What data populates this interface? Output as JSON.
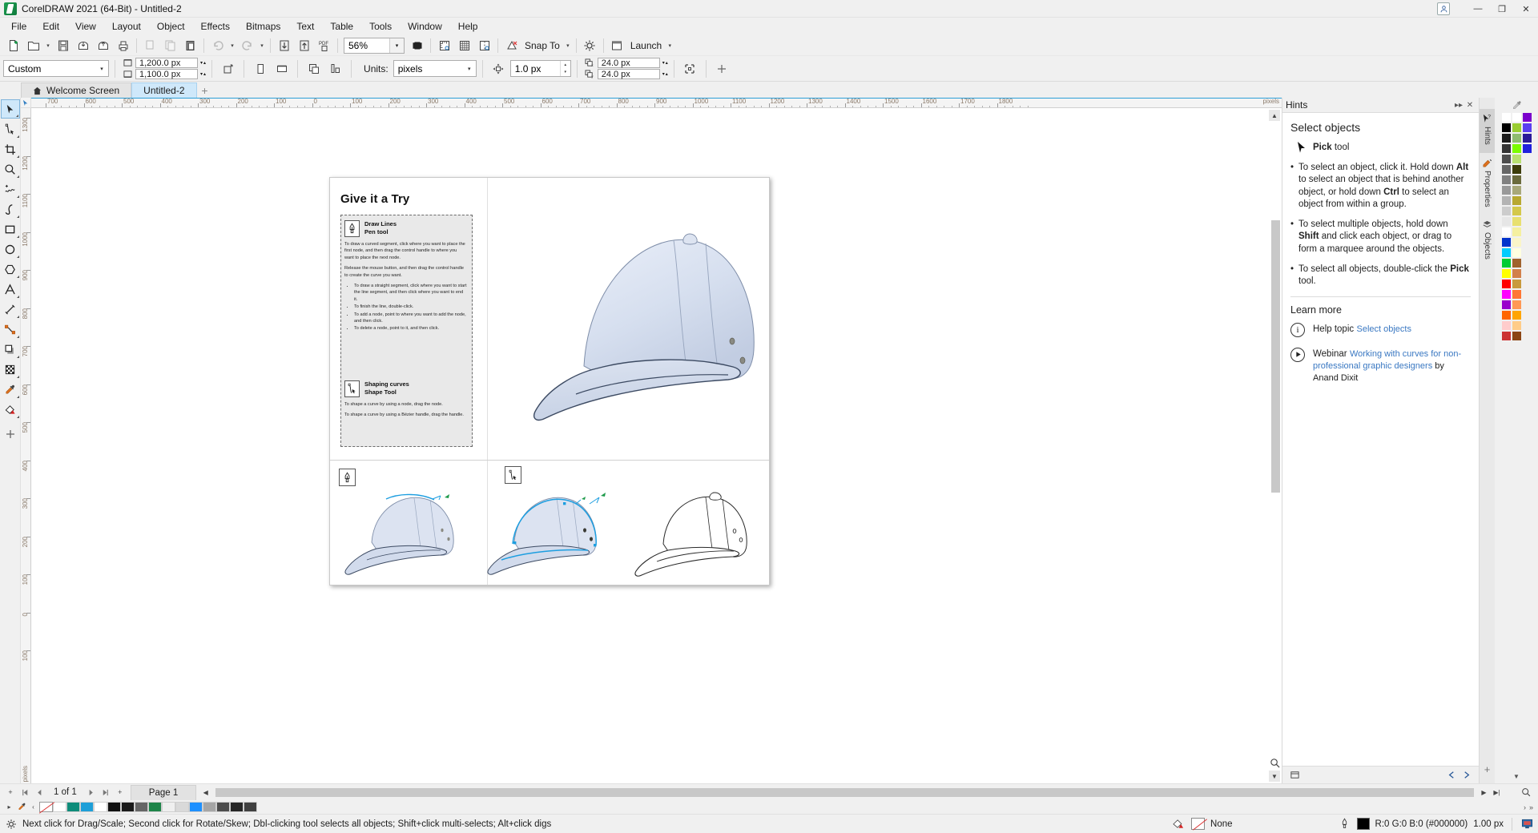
{
  "window": {
    "title": "CorelDRAW 2021 (64-Bit) - Untitled-2",
    "minimize": "—",
    "maximize": "❐",
    "close": "✕"
  },
  "menu": {
    "items": [
      "File",
      "Edit",
      "View",
      "Layout",
      "Object",
      "Effects",
      "Bitmaps",
      "Text",
      "Table",
      "Tools",
      "Window",
      "Help"
    ]
  },
  "toolbar": {
    "buttons": [
      {
        "name": "new-document",
        "tip": "New"
      },
      {
        "name": "open-document",
        "tip": "Open"
      },
      {
        "name": "save-document",
        "tip": "Save"
      },
      {
        "name": "import",
        "tip": "Import"
      },
      {
        "name": "export",
        "tip": "Export"
      },
      {
        "name": "print",
        "tip": "Print"
      },
      {
        "name": "cut",
        "tip": "Cut"
      },
      {
        "name": "copy",
        "tip": "Copy"
      },
      {
        "name": "paste",
        "tip": "Paste"
      },
      {
        "name": "undo",
        "tip": "Undo"
      },
      {
        "name": "redo",
        "tip": "Redo"
      },
      {
        "name": "import-arrow",
        "tip": "Import"
      },
      {
        "name": "export-arrow",
        "tip": "Export"
      },
      {
        "name": "publish-pdf",
        "tip": "Publish to PDF"
      }
    ],
    "zoom_level": "56%",
    "full_screen_tip": "Full-Screen Preview",
    "show_rulers_tip": "Show Rulers",
    "show_grid_tip": "Show Grid",
    "show_guides_tip": "Show Guides",
    "snap_label": "Snap To",
    "options_tip": "Options",
    "launch_label": "Launch"
  },
  "propbar": {
    "page_preset": "Custom",
    "page_width": "1,200.0 px",
    "page_height": "1,100.0 px",
    "units_label": "Units:",
    "units_value": "pixels",
    "nudge_value": "1.0 px",
    "duplicate_x": "24.0 px",
    "duplicate_y": "24.0 px",
    "portrait_tip": "Portrait",
    "landscape_tip": "Landscape",
    "add_tip": "Add"
  },
  "tabs": {
    "home_tip": "Home",
    "items": [
      {
        "label": "Welcome Screen",
        "active": false
      },
      {
        "label": "Untitled-2",
        "active": true
      }
    ],
    "add_label": "+"
  },
  "toolbox": {
    "tools": [
      {
        "name": "pick-tool",
        "active": true
      },
      {
        "name": "shape-tool",
        "active": false
      },
      {
        "name": "crop-tool",
        "active": false
      },
      {
        "name": "zoom-tool",
        "active": false
      },
      {
        "name": "freehand-tool",
        "active": false
      },
      {
        "name": "artistic-media-tool",
        "active": false
      },
      {
        "name": "rectangle-tool",
        "active": false
      },
      {
        "name": "ellipse-tool",
        "active": false
      },
      {
        "name": "polygon-tool",
        "active": false
      },
      {
        "name": "text-tool",
        "active": false
      },
      {
        "name": "parallel-dimension-tool",
        "active": false
      },
      {
        "name": "connector-tool",
        "active": false
      },
      {
        "name": "drop-shadow-tool",
        "active": false
      },
      {
        "name": "transparency-tool",
        "active": false
      },
      {
        "name": "color-eyedropper-tool",
        "active": false
      },
      {
        "name": "interactive-fill-tool",
        "active": false
      },
      {
        "name": "add-tool",
        "active": false
      }
    ]
  },
  "rulers": {
    "unit_label": "pixels",
    "h_labels": [
      "700",
      "600",
      "500",
      "400",
      "300",
      "200",
      "100",
      "0",
      "100",
      "200",
      "300",
      "400",
      "500",
      "600",
      "700",
      "800",
      "900",
      "1000",
      "1100",
      "1200",
      "1300",
      "1400",
      "1500",
      "1600",
      "1700",
      "1800"
    ],
    "v_labels": [
      "1300",
      "1200",
      "1100",
      "1000",
      "900",
      "800",
      "700",
      "600",
      "500",
      "400",
      "300",
      "200",
      "100",
      "0",
      "100"
    ]
  },
  "document": {
    "heading": "Give it a Try",
    "sections": [
      {
        "icon": "pen-tool-icon",
        "title": "Draw Lines",
        "subtitle": "Pen tool",
        "paragraphs": [
          "To draw a curved segment, click where you want to place the first node, and then drag the control handle to where you want to place the next node.",
          "Release the mouse button, and then drag the control handle to create the curve you want."
        ],
        "bullets": [
          "To draw a straight segment, click where you want to start the line segment, and then click where you want to end it.",
          "To finish the line, double-click.",
          "To add a node, point to where you want to add the node, and then click.",
          "To delete a node, point to it, and then click."
        ]
      },
      {
        "icon": "shape-tool-icon",
        "title": "Shaping curves",
        "subtitle": "Shape Tool",
        "paragraphs": [
          "To shape a curve by using a node, drag the node.",
          "To shape a curve by using a Bézier handle, drag the handle."
        ],
        "bullets": []
      }
    ],
    "strip_badges": [
      "pen-tool-icon",
      "shape-tool-icon"
    ]
  },
  "docker": {
    "title": "Hints",
    "collapse_icon": "▸▸",
    "close_icon": "✕",
    "heading": "Select objects",
    "tool_name_bold": "Pick",
    "tool_name_rest": " tool",
    "hints": [
      {
        "parts": [
          {
            "t": "To select an object, click it. Hold down ",
            "b": false
          },
          {
            "t": "Alt",
            "b": true
          },
          {
            "t": " to select an object that is behind another object, or hold down ",
            "b": false
          },
          {
            "t": "Ctrl",
            "b": true
          },
          {
            "t": " to select an object from within a group.",
            "b": false
          }
        ]
      },
      {
        "parts": [
          {
            "t": "To select multiple objects, hold down ",
            "b": false
          },
          {
            "t": "Shift",
            "b": true
          },
          {
            "t": " and click each object, or drag to form a marquee around the objects.",
            "b": false
          }
        ]
      },
      {
        "parts": [
          {
            "t": "To select all objects, double-click the ",
            "b": false
          },
          {
            "t": "Pick",
            "b": true
          },
          {
            "t": " tool.",
            "b": false
          }
        ]
      }
    ],
    "learn_more_heading": "Learn more",
    "learn_items": [
      {
        "icon": "info-icon",
        "title": "Help topic",
        "link": "Select objects",
        "link_suffix": ""
      },
      {
        "icon": "play-icon",
        "title": "Webinar",
        "link": "Working with curves for non-professional graphic designers",
        "link_suffix": " by Anand Dixit"
      }
    ],
    "rail_tabs": [
      {
        "label": "Hints",
        "icon": "pointer-question-icon",
        "active": true
      },
      {
        "label": "Properties",
        "icon": "properties-icon",
        "active": false
      },
      {
        "label": "Objects",
        "icon": "objects-icon",
        "active": false
      }
    ],
    "rail_add": "+"
  },
  "pagenav": {
    "add_page_left": "+",
    "first": "⏮",
    "prev": "◀",
    "counter": "1 of 1",
    "next": "▶",
    "last": "⏭",
    "add_page_right": "+",
    "page_tab": "Page 1"
  },
  "statusbar": {
    "message": "Next click for Drag/Scale; Second click for Rotate/Skew; Dbl-clicking tool selects all objects; Shift+click multi-selects; Alt+click digs",
    "outline_label": "None",
    "fill_color_text": "R:0 G:0 B:0 (#000000)",
    "outline_width": "1.00 px"
  },
  "palette": {
    "eyedropper_icon": "eyedropper-icon",
    "colors": [
      [
        "#ffffff",
        "#000000",
        "#1a1a1a",
        "#333333",
        "#4d4d4d",
        "#666666",
        "#808080",
        "#999999",
        "#b3b3b3",
        "#cccccc",
        "#e6e6e6",
        "#ffffff",
        "#0033cc",
        "#00ccff",
        "#00cc33",
        "#ffff00",
        "#ff0000",
        "#ff00ff",
        "#9900cc",
        "#ff6600",
        "#ffcccc",
        "#cc3333"
      ],
      [
        "#ffffff",
        "#9acd32",
        "#8fbc6f",
        "#7cfc00",
        "#b8e070",
        "#3d3d0a",
        "#6b6b3d",
        "#a8a87a",
        "#b8a830",
        "#d4c84a",
        "#e8e070",
        "#f5f0a0",
        "#faf5c8",
        "#ffffe0",
        "#a0622d",
        "#d2814a",
        "#c89a3c",
        "#ff7733",
        "#ff9955",
        "#ffa500",
        "#ffcc88",
        "#8b4513"
      ],
      [
        "#7a00cc",
        "#5a3ef0",
        "#2a1a9a",
        "#2020dd",
        "#f0f0f0",
        "#f0f0f0",
        "#f0f0f0",
        "#f0f0f0",
        "#f0f0f0",
        "#f0f0f0",
        "#f0f0f0",
        "#f0f0f0",
        "#f0f0f0",
        "#f0f0f0",
        "#f0f0f0",
        "#f0f0f0",
        "#f0f0f0",
        "#f0f0f0",
        "#f0f0f0",
        "#f0f0f0",
        "#f0f0f0",
        "#f0f0f0"
      ]
    ]
  },
  "colorstrip": {
    "swatches": [
      "#ffffff",
      "#0e8c7a",
      "#1e9fd8",
      "#ffffff",
      "#111111",
      "#1a1a1a",
      "#666666",
      "#1e8449",
      "#efefef",
      "#d9d9d9",
      "#1e90ff",
      "#a6a6a6",
      "#4d4d4d",
      "#262626",
      "#404040"
    ]
  },
  "theme": {
    "accent": "#cfe8fa",
    "chrome": "#f0f0f0",
    "link": "#3a78c2",
    "ruler_text": "#8a7a6a"
  }
}
